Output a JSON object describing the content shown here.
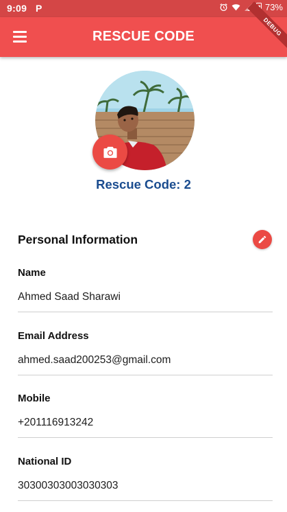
{
  "status_bar": {
    "time": "9:09",
    "app_glyph": "P",
    "battery_percent": "73%"
  },
  "app_bar": {
    "title": "RESCUE CODE",
    "debug_banner": "DEBUG"
  },
  "profile": {
    "rescue_code_label": "Rescue Code: 2"
  },
  "personal_info": {
    "section_title": "Personal Information",
    "fields": [
      {
        "label": "Name",
        "value": "Ahmed Saad Sharawi"
      },
      {
        "label": "Email Address",
        "value": "ahmed.saad200253@gmail.com"
      },
      {
        "label": "Mobile",
        "value": "+201116913242"
      },
      {
        "label": "National ID",
        "value": "30300303003030303"
      }
    ]
  },
  "colors": {
    "accent": "#f04f4f",
    "status_bar": "#d44646",
    "rescue_code_text": "#1a4c8f"
  },
  "icons": [
    "menu-icon",
    "camera-icon",
    "edit-icon",
    "alarm-icon",
    "wifi-icon",
    "signal-icon",
    "battery-icon"
  ]
}
